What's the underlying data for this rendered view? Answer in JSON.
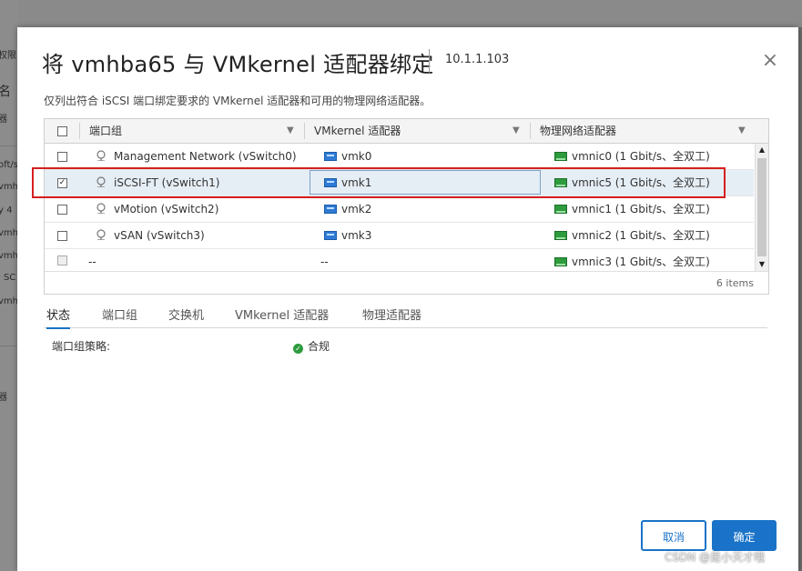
{
  "background": {
    "fragments": [
      "权限",
      "名",
      "器",
      "oft/s",
      "vmhba",
      "y 4",
      "vmhba",
      "vmhba",
      "i SC",
      "vmhba",
      "器"
    ]
  },
  "dialog": {
    "title": "将 vmhba65 与 VMkernel 适配器绑定",
    "host_ip": "10.1.1.103",
    "close_icon": "×",
    "description": "仅列出符合 iSCSI 端口绑定要求的 VMkernel 适配器和可用的物理网络适配器。"
  },
  "grid": {
    "columns": [
      "端口组",
      "VMkernel 适配器",
      "物理网络适配器"
    ],
    "rows": [
      {
        "checked": false,
        "portgroup": "Management Network (vSwitch0)",
        "vmk": "vmk0",
        "nic": "vmnic0 (1 Gbit/s、全双工)",
        "selected": false
      },
      {
        "checked": true,
        "portgroup": "iSCSI-FT (vSwitch1)",
        "vmk": "vmk1",
        "nic": "vmnic5 (1 Gbit/s、全双工)",
        "selected": true
      },
      {
        "checked": false,
        "portgroup": "vMotion (vSwitch2)",
        "vmk": "vmk2",
        "nic": "vmnic1 (1 Gbit/s、全双工)",
        "selected": false
      },
      {
        "checked": false,
        "portgroup": "vSAN (vSwitch3)",
        "vmk": "vmk3",
        "nic": "vmnic2 (1 Gbit/s、全双工)",
        "selected": false
      },
      {
        "checked": false,
        "portgroup": "--",
        "vmk": "--",
        "nic": "vmnic3 (1 Gbit/s、全双工)",
        "selected": false
      }
    ],
    "item_count": "6 items",
    "check_mark": "✓",
    "filter_icon": "▼"
  },
  "tabs": [
    "状态",
    "端口组",
    "交换机",
    "VMkernel 适配器",
    "物理适配器"
  ],
  "details": {
    "label": "端口组策略:",
    "value": "合规",
    "status_icon": "✓"
  },
  "buttons": {
    "cancel": "取消",
    "ok": "确定"
  },
  "watermark": "CSDN @是小天才哦",
  "colors": {
    "accent": "#1a73c8",
    "highlight_box": "#d61f1f",
    "ok_green": "#2e9b3d"
  }
}
